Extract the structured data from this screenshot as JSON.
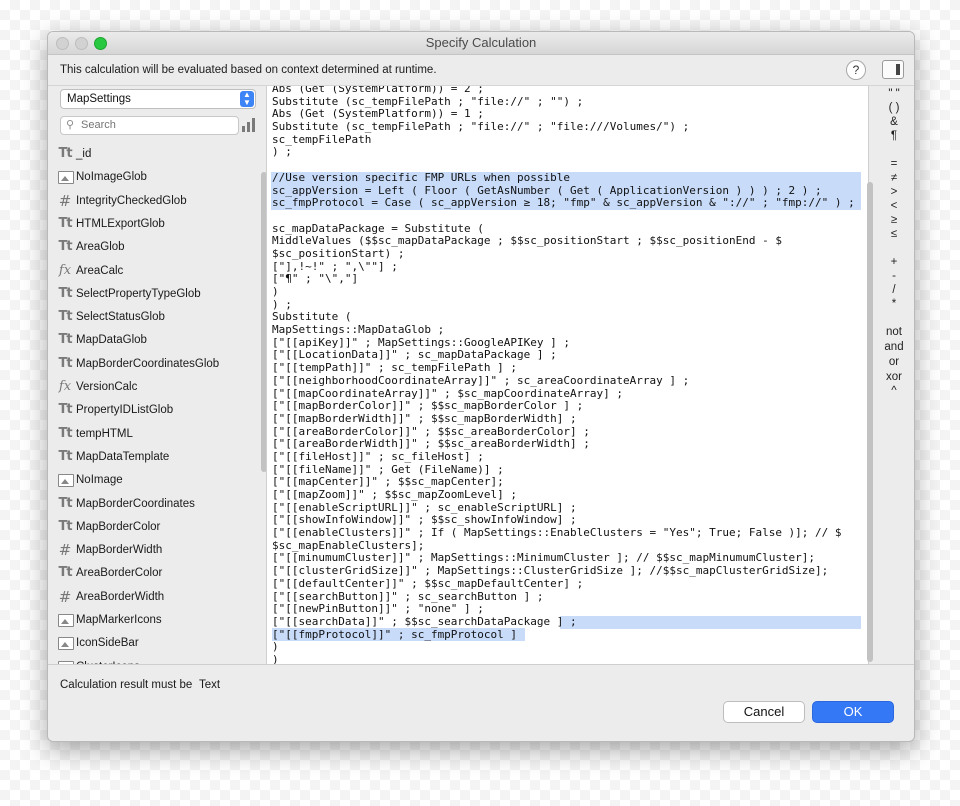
{
  "window": {
    "title": "Specify Calculation",
    "info_text": "This calculation will be evaluated based on context determined at runtime.",
    "help_label": "?"
  },
  "sidebar": {
    "table_selected": "MapSettings",
    "search_placeholder": "Search",
    "fields": [
      {
        "type": "text-icon",
        "icon_glyph": "Tt",
        "label": "_id"
      },
      {
        "type": "image-icon",
        "icon_glyph": "",
        "label": "NoImageGlob"
      },
      {
        "type": "number-icon",
        "icon_glyph": "#",
        "label": "IntegrityCheckedGlob"
      },
      {
        "type": "text-icon",
        "icon_glyph": "Tt",
        "label": "HTMLExportGlob"
      },
      {
        "type": "text-icon",
        "icon_glyph": "Tt",
        "label": "AreaGlob"
      },
      {
        "type": "calc-icon",
        "icon_glyph": "fx",
        "label": "AreaCalc"
      },
      {
        "type": "text-icon",
        "icon_glyph": "Tt",
        "label": "SelectPropertyTypeGlob"
      },
      {
        "type": "text-icon",
        "icon_glyph": "Tt",
        "label": "SelectStatusGlob"
      },
      {
        "type": "text-icon",
        "icon_glyph": "Tt",
        "label": "MapDataGlob"
      },
      {
        "type": "text-icon",
        "icon_glyph": "Tt",
        "label": "MapBorderCoordinatesGlob"
      },
      {
        "type": "calc-icon",
        "icon_glyph": "fx",
        "label": "VersionCalc"
      },
      {
        "type": "text-icon",
        "icon_glyph": "Tt",
        "label": "PropertyIDListGlob"
      },
      {
        "type": "text-icon",
        "icon_glyph": "Tt",
        "label": "tempHTML"
      },
      {
        "type": "text-icon",
        "icon_glyph": "Tt",
        "label": "MapDataTemplate"
      },
      {
        "type": "image-icon",
        "icon_glyph": "",
        "label": "NoImage"
      },
      {
        "type": "text-icon",
        "icon_glyph": "Tt",
        "label": "MapBorderCoordinates"
      },
      {
        "type": "text-icon",
        "icon_glyph": "Tt",
        "label": "MapBorderColor"
      },
      {
        "type": "number-icon",
        "icon_glyph": "#",
        "label": "MapBorderWidth"
      },
      {
        "type": "text-icon",
        "icon_glyph": "Tt",
        "label": "AreaBorderColor"
      },
      {
        "type": "number-icon",
        "icon_glyph": "#",
        "label": "AreaBorderWidth"
      },
      {
        "type": "image-icon",
        "icon_glyph": "",
        "label": "MapMarkerIcons"
      },
      {
        "type": "image-icon",
        "icon_glyph": "",
        "label": "IconSideBar"
      },
      {
        "type": "image-icon",
        "icon_glyph": "",
        "label": "ClusterIcons"
      }
    ]
  },
  "editor": {
    "lines": [
      {
        "text": "Abs (Get (SystemPlatform)) = 2 ;",
        "highlight": "none"
      },
      {
        "text": "Substitute (sc_tempFilePath ; \"file://\" ; \"\") ;",
        "highlight": "none"
      },
      {
        "text": "Abs (Get (SystemPlatform)) = 1 ;",
        "highlight": "none"
      },
      {
        "text": "Substitute (sc_tempFilePath ; \"file://\" ; \"file:///Volumes/\") ;",
        "highlight": "none"
      },
      {
        "text": "sc_tempFilePath",
        "highlight": "none"
      },
      {
        "text": ") ;",
        "highlight": "none"
      },
      {
        "text": "",
        "highlight": "none"
      },
      {
        "text": "//Use version specific FMP URLs when possible",
        "highlight": "full"
      },
      {
        "text": "sc_appVersion = Left ( Floor ( GetAsNumber ( Get ( ApplicationVersion ) ) ) ; 2 ) ;",
        "highlight": "full"
      },
      {
        "text": "sc_fmpProtocol = Case ( sc_appVersion ≥ 18; \"fmp\" & sc_appVersion & \"://\" ; \"fmp://\" ) ;",
        "highlight": "full"
      },
      {
        "text": "",
        "highlight": "none"
      },
      {
        "text": "sc_mapDataPackage = Substitute (",
        "highlight": "none"
      },
      {
        "text": "MiddleValues ($$sc_mapDataPackage ; $$sc_positionStart ; $$sc_positionEnd - $",
        "highlight": "none"
      },
      {
        "text": "$sc_positionStart) ;",
        "highlight": "none"
      },
      {
        "text": "[\"],!~!\" ; \",\\\"\"] ;",
        "highlight": "none"
      },
      {
        "text": "[\"¶\" ; \"\\\",\"]",
        "highlight": "none"
      },
      {
        "text": ")",
        "highlight": "none"
      },
      {
        "text": ") ;",
        "highlight": "none"
      },
      {
        "text": "Substitute (",
        "highlight": "none"
      },
      {
        "text": "MapSettings::MapDataGlob ;",
        "highlight": "none"
      },
      {
        "text": "[\"[[apiKey]]\" ; MapSettings::GoogleAPIKey ] ;",
        "highlight": "none"
      },
      {
        "text": "[\"[[LocationData]]\" ; sc_mapDataPackage ] ;",
        "highlight": "none"
      },
      {
        "text": "[\"[[tempPath]]\" ; sc_tempFilePath ] ;",
        "highlight": "none"
      },
      {
        "text": "[\"[[neighborhoodCoordinateArray]]\" ; sc_areaCoordinateArray ] ;",
        "highlight": "none"
      },
      {
        "text": "[\"[[mapCoordinateArray]]\" ; $sc_mapCoordinateArray] ;",
        "highlight": "none"
      },
      {
        "text": "[\"[[mapBorderColor]]\" ; $$sc_mapBorderColor ] ;",
        "highlight": "none"
      },
      {
        "text": "[\"[[mapBorderWidth]]\" ; $$sc_mapBorderWidth] ;",
        "highlight": "none"
      },
      {
        "text": "[\"[[areaBorderColor]]\" ; $$sc_areaBorderColor] ;",
        "highlight": "none"
      },
      {
        "text": "[\"[[areaBorderWidth]]\" ; $$sc_areaBorderWidth] ;",
        "highlight": "none"
      },
      {
        "text": "[\"[[fileHost]]\" ; sc_fileHost] ;",
        "highlight": "none"
      },
      {
        "text": "[\"[[fileName]]\" ; Get (FileName)] ;",
        "highlight": "none"
      },
      {
        "text": "[\"[[mapCenter]]\" ; $$sc_mapCenter];",
        "highlight": "none"
      },
      {
        "text": "[\"[[mapZoom]]\" ; $$sc_mapZoomLevel] ;",
        "highlight": "none"
      },
      {
        "text": "[\"[[enableScriptURL]]\" ; sc_enableScriptURL] ;",
        "highlight": "none"
      },
      {
        "text": "[\"[[showInfoWindow]]\" ; $$sc_showInfoWindow] ;",
        "highlight": "none"
      },
      {
        "text": "[\"[[enableClusters]]\" ; If ( MapSettings::EnableClusters = \"Yes\"; True; False )]; // $",
        "highlight": "none"
      },
      {
        "text": "$sc_mapEnableClusters];",
        "highlight": "none"
      },
      {
        "text": "[\"[[minumumCluster]]\" ; MapSettings::MinimumCluster ]; // $$sc_mapMinumumCluster];",
        "highlight": "none"
      },
      {
        "text": "[\"[[clusterGridSize]]\" ; MapSettings::ClusterGridSize ]; //$$sc_mapClusterGridSize];",
        "highlight": "none"
      },
      {
        "text": "[\"[[defaultCenter]]\" ; $$sc_mapDefaultCenter] ;",
        "highlight": "none"
      },
      {
        "text": "[\"[[searchButton]]\" ; sc_searchButton ] ;",
        "highlight": "none"
      },
      {
        "text": "[\"[[newPinButton]]\" ; \"none\" ] ;",
        "highlight": "none"
      },
      {
        "text": "[\"[[searchData]]\" ; $$sc_searchDataPackage ] ;",
        "highlight": "tail"
      },
      {
        "text": "[\"[[fmpProtocol]]\" ; sc_fmpProtocol ]",
        "highlight": "partial"
      },
      {
        "text": ")",
        "highlight": "none"
      },
      {
        "text": ")",
        "highlight": "none"
      }
    ]
  },
  "operators": [
    "\" \"",
    "( )",
    "&",
    "¶",
    "=",
    "≠",
    ">",
    "<",
    "≥",
    "≤",
    "+",
    "-",
    "/",
    "*",
    "not",
    "and",
    "or",
    "xor",
    "^"
  ],
  "footer": {
    "result_label": "Calculation result must be",
    "result_type": "Text",
    "cancel_label": "Cancel",
    "ok_label": "OK"
  }
}
